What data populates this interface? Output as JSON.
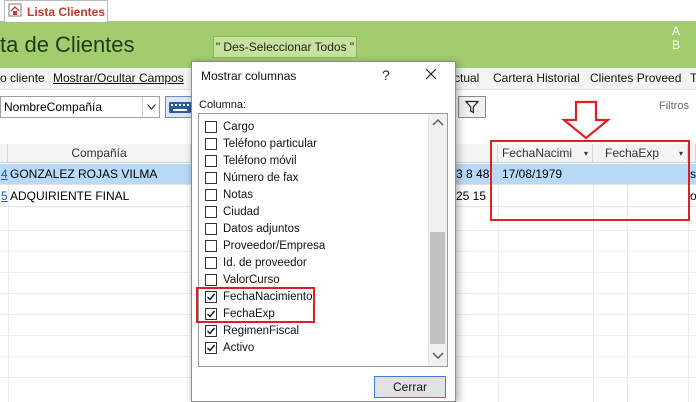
{
  "tab": {
    "label": "Lista Clientes",
    "icon": "form-icon"
  },
  "header": {
    "title": "ta de Clientes",
    "deselect_label": "\" Des-Seleccionar Todos \"",
    "letters": "A B",
    "color": "#a2cd6f"
  },
  "menu": {
    "items": [
      "o cliente",
      "Mostrar/Ocultar Campos",
      "ctual",
      "Cartera Historial",
      "Clientes Proveed",
      "T"
    ]
  },
  "toolbar": {
    "combo_value": "NombreCompañía",
    "filtros_label": "Filtros"
  },
  "grid": {
    "headers": {
      "compania": "Compañía",
      "fecha_nac": "FechaNacimi",
      "fecha_exp": "FechaExp"
    },
    "rows": [
      {
        "id": "4",
        "compania": "GONZALEZ ROJAS VILMA",
        "telefono": "3 8 48",
        "fecha_nac": "17/08/1979",
        "fecha_exp": "",
        "extra": "s"
      },
      {
        "id": "5",
        "compania": "ADQUIRIENTE  FINAL",
        "telefono": "25 15",
        "fecha_nac": "",
        "fecha_exp": "",
        "extra": "o"
      }
    ]
  },
  "dialog": {
    "title": "Mostrar columnas",
    "help": "?",
    "column_label": "Columna:",
    "items": [
      {
        "label": "Cargo",
        "checked": false
      },
      {
        "label": "Teléfono particular",
        "checked": false
      },
      {
        "label": "Teléfono móvil",
        "checked": false
      },
      {
        "label": "Número de fax",
        "checked": false
      },
      {
        "label": "Notas",
        "checked": false
      },
      {
        "label": "Ciudad",
        "checked": false
      },
      {
        "label": "Datos adjuntos",
        "checked": false
      },
      {
        "label": "Proveedor/Empresa",
        "checked": false
      },
      {
        "label": "Id. de proveedor",
        "checked": false
      },
      {
        "label": "ValorCurso",
        "checked": false
      },
      {
        "label": "FechaNacimiento",
        "checked": true
      },
      {
        "label": "FechaExp",
        "checked": true
      },
      {
        "label": "RegimenFiscal",
        "checked": true
      },
      {
        "label": "Activo",
        "checked": true
      }
    ],
    "close_label": "Cerrar"
  },
  "highlight_color": "#e02020"
}
